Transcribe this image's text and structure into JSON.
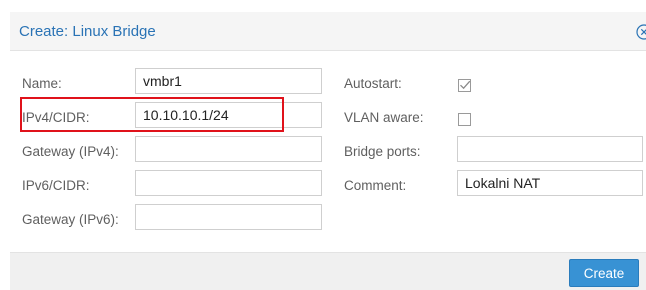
{
  "dialog": {
    "title": "Create: Linux Bridge",
    "close_icon": "close-circle-icon"
  },
  "left_fields": [
    {
      "label": "Name:",
      "value": "vmbr1"
    },
    {
      "label": "IPv4/CIDR:",
      "value": "10.10.10.1/24"
    },
    {
      "label": "Gateway (IPv4):",
      "value": ""
    },
    {
      "label": "IPv6/CIDR:",
      "value": ""
    },
    {
      "label": "Gateway (IPv6):",
      "value": ""
    }
  ],
  "right_fields": {
    "autostart": {
      "label": "Autostart:",
      "checked": true
    },
    "vlan_aware": {
      "label": "VLAN aware:",
      "checked": false
    },
    "bridge_ports": {
      "label": "Bridge ports:",
      "value": ""
    },
    "comment": {
      "label": "Comment:",
      "value": "Lokalni NAT"
    }
  },
  "footer": {
    "create_label": "Create"
  },
  "colors": {
    "title": "#2a73b5",
    "button": "#3892d4",
    "highlight": "#e0121b"
  }
}
